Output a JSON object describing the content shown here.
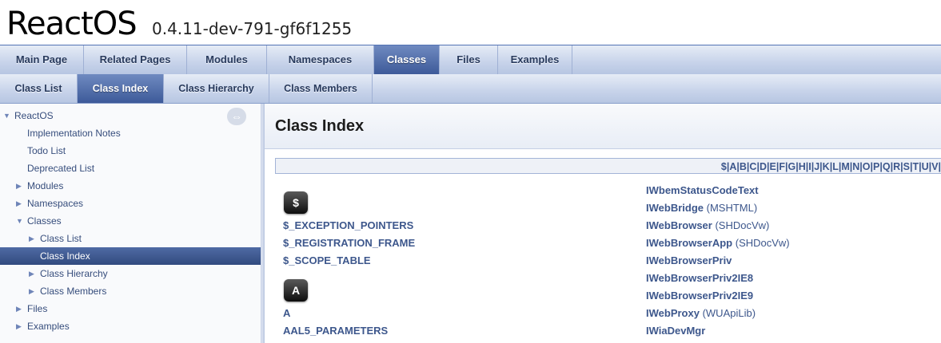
{
  "project": {
    "name": "ReactOS",
    "number": "0.4.11-dev-791-gf6f1255"
  },
  "main_tabs": [
    "Main Page",
    "Related Pages",
    "Modules",
    "Namespaces",
    "Classes",
    "Files",
    "Examples"
  ],
  "main_tabs_active": "Classes",
  "sub_tabs": [
    "Class List",
    "Class Index",
    "Class Hierarchy",
    "Class Members"
  ],
  "sub_tabs_active": "Class Index",
  "nav_tree": [
    {
      "label": "ReactOS",
      "arrow": "▼",
      "selected": false
    },
    {
      "label": "Implementation Notes",
      "arrow": "",
      "selected": false
    },
    {
      "label": "Todo List",
      "arrow": "",
      "selected": false
    },
    {
      "label": "Deprecated List",
      "arrow": "",
      "selected": false
    },
    {
      "label": "Modules",
      "arrow": "▶",
      "selected": false
    },
    {
      "label": "Namespaces",
      "arrow": "▶",
      "selected": false
    },
    {
      "label": "Classes",
      "arrow": "▼",
      "selected": false
    },
    {
      "label": "Class List",
      "arrow": "▶",
      "selected": false
    },
    {
      "label": "Class Index",
      "arrow": "",
      "selected": true
    },
    {
      "label": "Class Hierarchy",
      "arrow": "▶",
      "selected": false
    },
    {
      "label": "Class Members",
      "arrow": "▶",
      "selected": false
    },
    {
      "label": "Files",
      "arrow": "▶",
      "selected": false
    },
    {
      "label": "Examples",
      "arrow": "▶",
      "selected": false
    }
  ],
  "sync_icon": "sync-arrows-icon",
  "content": {
    "title": "Class Index",
    "letters": [
      "$",
      "A",
      "B",
      "C",
      "D",
      "E",
      "F",
      "G",
      "H",
      "I",
      "J",
      "K",
      "L",
      "M",
      "N",
      "O",
      "P",
      "Q",
      "R",
      "S",
      "T",
      "U",
      "V"
    ],
    "left_column": [
      {
        "type": "badge",
        "text": "$"
      },
      {
        "type": "class",
        "name": "$_EXCEPTION_POINTERS",
        "ns": ""
      },
      {
        "type": "class",
        "name": "$_REGISTRATION_FRAME",
        "ns": ""
      },
      {
        "type": "class",
        "name": "$_SCOPE_TABLE",
        "ns": ""
      },
      {
        "type": "badge",
        "text": "A"
      },
      {
        "type": "class",
        "name": "A",
        "ns": ""
      },
      {
        "type": "class",
        "name": "AAL5_PARAMETERS",
        "ns": ""
      }
    ],
    "right_column": [
      {
        "name": "IWbemStatusCodeText",
        "ns": ""
      },
      {
        "name": "IWebBridge",
        "ns": "(MSHTML)"
      },
      {
        "name": "IWebBrowser",
        "ns": "(SHDocVw)"
      },
      {
        "name": "IWebBrowserApp",
        "ns": "(SHDocVw)"
      },
      {
        "name": "IWebBrowserPriv",
        "ns": ""
      },
      {
        "name": "IWebBrowserPriv2IE8",
        "ns": ""
      },
      {
        "name": "IWebBrowserPriv2IE9",
        "ns": ""
      },
      {
        "name": "IWebProxy",
        "ns": "(WUApiLib)"
      },
      {
        "name": "IWiaDevMgr",
        "ns": ""
      }
    ]
  },
  "colors": {
    "link": "#3d578c",
    "active_tab": "#3d5a99",
    "selected_nav": "#324b7f"
  }
}
